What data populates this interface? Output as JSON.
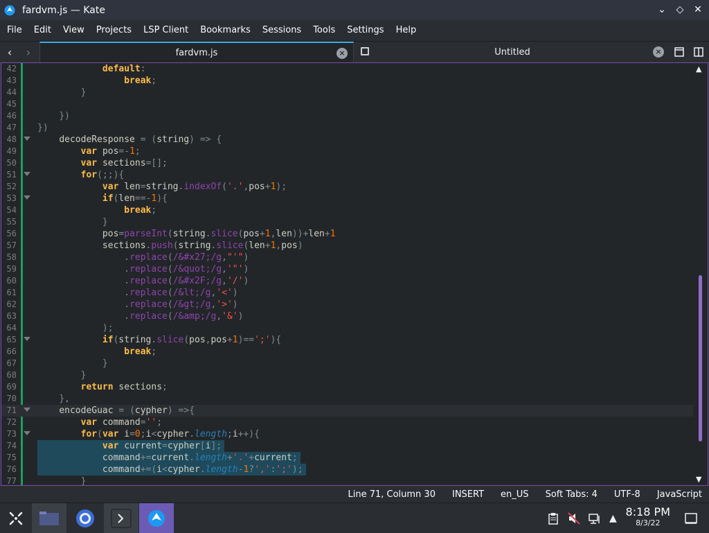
{
  "window": {
    "title": "fardvm.js — Kate",
    "app_icon": "kate-icon"
  },
  "menu": [
    "File",
    "Edit",
    "View",
    "Projects",
    "LSP Client",
    "Bookmarks",
    "Sessions",
    "Tools",
    "Settings",
    "Help"
  ],
  "tabs": [
    {
      "label": "fardvm.js",
      "active": true
    },
    {
      "label": "Untitled",
      "active": false
    }
  ],
  "editor": {
    "lines": [
      {
        "n": "42",
        "fold": false
      },
      {
        "n": "43",
        "fold": false
      },
      {
        "n": "44",
        "fold": false
      },
      {
        "n": "45",
        "fold": false
      },
      {
        "n": "46",
        "fold": false
      },
      {
        "n": "47",
        "fold": false
      },
      {
        "n": "48",
        "fold": true
      },
      {
        "n": "49",
        "fold": false
      },
      {
        "n": "50",
        "fold": false
      },
      {
        "n": "51",
        "fold": true
      },
      {
        "n": "52",
        "fold": false
      },
      {
        "n": "53",
        "fold": true
      },
      {
        "n": "54",
        "fold": false
      },
      {
        "n": "55",
        "fold": false
      },
      {
        "n": "56",
        "fold": false
      },
      {
        "n": "57",
        "fold": false
      },
      {
        "n": "58",
        "fold": false
      },
      {
        "n": "59",
        "fold": false
      },
      {
        "n": "60",
        "fold": false
      },
      {
        "n": "61",
        "fold": false
      },
      {
        "n": "62",
        "fold": false
      },
      {
        "n": "63",
        "fold": false
      },
      {
        "n": "64",
        "fold": false
      },
      {
        "n": "65",
        "fold": true
      },
      {
        "n": "66",
        "fold": false
      },
      {
        "n": "67",
        "fold": false
      },
      {
        "n": "68",
        "fold": false
      },
      {
        "n": "69",
        "fold": false
      },
      {
        "n": "70",
        "fold": false
      },
      {
        "n": "71",
        "fold": true
      },
      {
        "n": "72",
        "fold": false
      },
      {
        "n": "73",
        "fold": true
      },
      {
        "n": "74",
        "fold": false
      },
      {
        "n": "75",
        "fold": false
      },
      {
        "n": "76",
        "fold": false
      },
      {
        "n": "77",
        "fold": false
      }
    ],
    "code_lines": [
      "            default:",
      "                break;",
      "        }",
      "",
      "    })",
      "})",
      "    decodeResponse = (string) => {",
      "        var pos=-1;",
      "        var sections=[];",
      "        for(;;){",
      "            var len=string.indexOf('.',pos+1);",
      "            if(len==-1){",
      "                break;",
      "            }",
      "            pos=parseInt(string.slice(pos+1,len))+len+1",
      "            sections.push(string.slice(len+1,pos)",
      "                .replace(/&#x27;/g,\"'\")",
      "                .replace(/&quot;/g,'\"')",
      "                .replace(/&#x2F;/g,'/')",
      "                .replace(/&lt;/g,'<')",
      "                .replace(/&gt;/g,'>')",
      "                .replace(/&amp;/g,'&')",
      "            );",
      "            if(string.slice(pos,pos+1)==';'){",
      "                break;",
      "            }",
      "        }",
      "        return sections;",
      "    },",
      "    encodeGuac = (cypher) =>{",
      "        var command='';",
      "        for(var i=0;i<cypher.length;i++){",
      "            var current=cypher[i];",
      "            command+=current.length+'.'+current;",
      "            command+=(i<cypher.length-1?',':';');",
      "        }"
    ]
  },
  "status": {
    "position": "Line 71, Column 30",
    "mode": "INSERT",
    "lang_dict": "en_US",
    "tabs": "Soft Tabs: 4",
    "encoding": "UTF-8",
    "syntax": "JavaScript"
  },
  "clock": {
    "time": "8:18 PM",
    "date": "8/3/22"
  }
}
